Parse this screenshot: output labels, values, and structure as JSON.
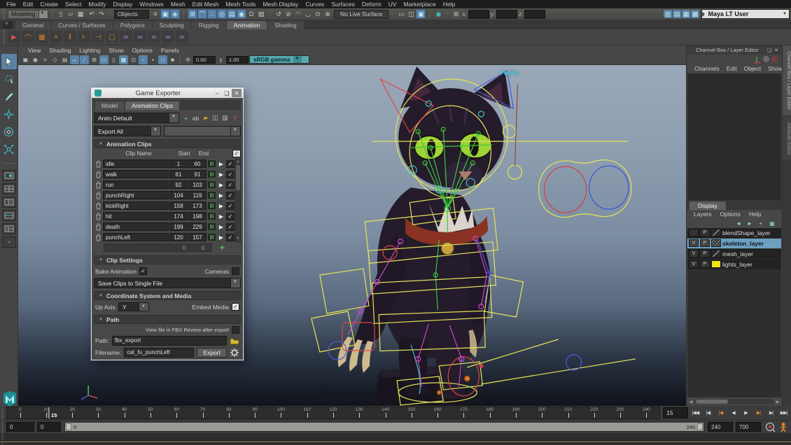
{
  "menubar": [
    "File",
    "Edit",
    "Create",
    "Select",
    "Modify",
    "Display",
    "Windows",
    "Mesh",
    "Edit Mesh",
    "Mesh Tools",
    "Mesh Display",
    "Curves",
    "Surfaces",
    "Deform",
    "UV",
    "Marketplace",
    "Help"
  ],
  "statusline": {
    "mode": "Modeling",
    "objects_filter": "Objects",
    "live_surface": "No Live Surface",
    "x_label": "x:",
    "y_label": "y:",
    "z_label": "z:",
    "user": "Maya LT User",
    "file_icons": [
      {
        "n": "new-scene-icon",
        "g": "▯"
      },
      {
        "n": "open-scene-icon",
        "g": "▱"
      },
      {
        "n": "save-scene-icon",
        "g": "▦"
      }
    ],
    "undo_icons": [
      {
        "n": "undo-icon",
        "g": "↶"
      },
      {
        "n": "redo-icon",
        "g": "↷"
      }
    ],
    "selection_mask_icons": [
      {
        "n": "select-hierarchy-icon",
        "g": "≡",
        "a": ""
      },
      {
        "n": "select-object-icon",
        "g": "▣",
        "a": "active"
      },
      {
        "n": "select-component-icon",
        "g": "◈",
        "a": "active"
      }
    ],
    "snap_icons": [
      {
        "n": "snap-grid-icon",
        "g": "⊞",
        "a": "active"
      },
      {
        "n": "snap-curve-icon",
        "g": "⌒",
        "a": "active"
      },
      {
        "n": "snap-point-icon",
        "g": "∴",
        "a": "active"
      },
      {
        "n": "snap-projected-center-icon",
        "g": "◎",
        "a": "active"
      },
      {
        "n": "snap-view-plane-icon",
        "g": "▤",
        "a": "active"
      },
      {
        "n": "make-live-icon",
        "g": "◉",
        "a": "active"
      },
      {
        "n": "lock-selection-icon",
        "g": "Ω",
        "a": ""
      },
      {
        "n": "highlight-selection-icon",
        "g": "▧",
        "a": ""
      }
    ],
    "history_icons": [
      {
        "n": "construction-history-icon",
        "g": "↺"
      },
      {
        "n": "no-construction-history-icon",
        "g": "⊘"
      },
      {
        "n": "evaluate-begin-icon",
        "g": "◠"
      },
      {
        "n": "evaluate-end-icon",
        "g": "◡"
      },
      {
        "n": "dirty-propagation-icon",
        "g": "⊙"
      },
      {
        "n": "cycle-check-icon",
        "g": "⊗"
      }
    ],
    "panel_icons": [
      {
        "n": "single-pane-icon",
        "g": "▭",
        "a": ""
      },
      {
        "n": "multi-pane-icon",
        "g": "◫",
        "a": ""
      },
      {
        "n": "hypershade-icon",
        "g": "▣",
        "a": "active"
      }
    ],
    "render_icons": [
      {
        "n": "render-view-icon",
        "g": "◉",
        "a": "teal"
      }
    ],
    "grid_icon": {
      "n": "grid-coords-icon",
      "g": "⊞"
    },
    "workspace_icons": [
      {
        "n": "ui-elements-toggle-icon",
        "g": "▥"
      },
      {
        "n": "channel-box-toggle-icon",
        "g": "▤"
      },
      {
        "n": "attribute-editor-toggle-icon",
        "g": "▦"
      },
      {
        "n": "tool-settings-toggle-icon",
        "g": "▩"
      }
    ],
    "user_icon_glyph": "☻"
  },
  "shelf": {
    "tabs": [
      {
        "label": "General",
        "state": ""
      },
      {
        "label": "Curves / Surfaces",
        "state": ""
      },
      {
        "label": "Polygons",
        "state": ""
      },
      {
        "label": "Sculpting",
        "state": ""
      },
      {
        "label": "Rigging",
        "state": ""
      },
      {
        "label": "Animation",
        "state": "active"
      },
      {
        "label": "Shading",
        "state": ""
      }
    ],
    "icons": [
      {
        "n": "playblast-icon",
        "g": "▶",
        "cls": "red"
      },
      {
        "n": "motion-trail-icon",
        "g": "⌒",
        "cls": ""
      },
      {
        "n": "dope-sheet-icon",
        "g": "▦",
        "cls": ""
      },
      {
        "n": "set-key-icon",
        "g": "+",
        "cls": ""
      },
      {
        "n": "set-breakdown-icon",
        "g": "‖",
        "cls": ""
      },
      {
        "n": "add-inbetween-icon",
        "g": "⊦",
        "cls": ""
      },
      {
        "n": "remove-inbetween-icon",
        "g": "⊣",
        "cls": ""
      },
      {
        "n": "anim-snapshot-icon",
        "g": "▢",
        "cls": ""
      },
      {
        "n": "parent-constraint-icon",
        "g": "∞",
        "cls": "purple"
      },
      {
        "n": "point-constraint-icon",
        "g": "∞",
        "cls": "purple"
      },
      {
        "n": "orient-constraint-icon",
        "g": "∞",
        "cls": "purple"
      },
      {
        "n": "aim-constraint-icon",
        "g": "∞",
        "cls": "purple"
      },
      {
        "n": "pole-vector-constraint-icon",
        "g": "∞",
        "cls": "purple"
      }
    ]
  },
  "panel_menu": {
    "items": [
      "View",
      "Shading",
      "Lighting",
      "Show",
      "Options",
      "Panels"
    ],
    "icons": [
      {
        "n": "select-camera-icon",
        "g": "▣",
        "a": ""
      },
      {
        "n": "lock-camera-icon",
        "g": "◉",
        "a": ""
      },
      {
        "n": "camera-attributes-icon",
        "g": "≡",
        "a": ""
      },
      {
        "n": "bookmark-icon",
        "g": "◇",
        "a": ""
      },
      {
        "n": "image-plane-icon",
        "g": "▤",
        "a": ""
      },
      {
        "n": "two-d-pan-zoom-icon",
        "g": "↔",
        "a": "on"
      },
      {
        "n": "grease-pencil-icon",
        "g": "∕",
        "a": "on"
      },
      {
        "n": "grid-toggle-icon",
        "g": "⊞",
        "a": ""
      },
      {
        "n": "film-gate-icon",
        "g": "▭",
        "a": "on"
      },
      {
        "n": "resolution-gate-icon",
        "g": "▯",
        "a": ""
      },
      {
        "n": "gate-mask-icon",
        "g": "▩",
        "a": "on"
      },
      {
        "n": "field-chart-icon",
        "g": "⊡",
        "a": ""
      },
      {
        "n": "safe-action-icon",
        "g": "▫",
        "a": "on"
      },
      {
        "n": "safe-title-icon",
        "g": "▪",
        "a": ""
      },
      {
        "n": "isolate-select-icon",
        "g": "□",
        "a": "on"
      },
      {
        "n": "xray-icon",
        "g": "■",
        "a": ""
      }
    ],
    "exposure": "0.00",
    "gamma": "1.00",
    "color_mode": "sRGB gamma"
  },
  "viewport": {
    "pupils_label": "Pupils",
    "panzoom_label": "2D Pan/Zoom : persp"
  },
  "exporter": {
    "title": "Game Exporter",
    "window_buttons": [
      {
        "n": "minimize-button",
        "g": "–",
        "cls": ""
      },
      {
        "n": "maximize-button",
        "g": "❑",
        "cls": ""
      },
      {
        "n": "close-button",
        "g": "✕",
        "cls": "close"
      }
    ],
    "tabs": [
      {
        "label": "Model",
        "state": ""
      },
      {
        "label": "Animation Clips",
        "state": "active"
      }
    ],
    "preset": "Anim Default",
    "preset_icons": [
      {
        "n": "create-anim-clip-set-icon",
        "g": "+",
        "cls": "ic-green"
      },
      {
        "n": "rename-anim-clip-set-icon",
        "g": "ab",
        "cls": ""
      },
      {
        "n": "load-anim-clip-set-icon",
        "g": "▰",
        "cls": "ic-folder"
      },
      {
        "n": "duplicate-anim-clip-set-icon",
        "g": "◫",
        "cls": ""
      },
      {
        "n": "delete-anim-clip-set-icon",
        "g": "▥",
        "cls": ""
      },
      {
        "n": "help-icon",
        "g": "?",
        "cls": "ic-red"
      }
    ],
    "export_mode": "Export All",
    "sections": {
      "clips": "Animation Clips",
      "clip_settings": "Clip Settings",
      "coordinate": "Coordinate System and Media",
      "path": "Path"
    },
    "clips_header": {
      "name": "Clip Name",
      "start": "Start",
      "end": "End"
    },
    "clips": [
      {
        "name": "idle",
        "start": "1",
        "end": "60"
      },
      {
        "name": "walk",
        "start": "61",
        "end": "91"
      },
      {
        "name": "run",
        "start": "92",
        "end": "103"
      },
      {
        "name": "punchRight",
        "start": "104",
        "end": "119"
      },
      {
        "name": "kickRight",
        "start": "158",
        "end": "173"
      },
      {
        "name": "hit",
        "start": "174",
        "end": "198"
      },
      {
        "name": "death",
        "start": "199",
        "end": "229"
      },
      {
        "name": "punchLeft",
        "start": "120",
        "end": "157"
      }
    ],
    "empty_row": {
      "start": "0",
      "end": "0"
    },
    "clip_settings": {
      "bake_label": "Bake Animation",
      "cameras_label": "Cameras",
      "save_mode": "Save Clips to Single File"
    },
    "coordinate": {
      "up_axis_label": "Up Axis",
      "up_axis": "Y",
      "embed_label": "Embed Media"
    },
    "path_section": {
      "fbx_review_label": "View file in FBX Review after export",
      "path_label": "Path:",
      "path_value": "fbx_export",
      "filename_label": "Filename:",
      "filename_value": "cat_fu_punchLeft",
      "export_label": "Export"
    }
  },
  "channel_box": {
    "title": "Channel Box / Layer Editor",
    "menus": [
      "Channels",
      "Edit",
      "Object",
      "Show"
    ],
    "side_tabs": [
      {
        "label": "Channel Box / Layer Editor",
        "state": ""
      },
      {
        "label": "Attribute Editor",
        "state": "dim"
      }
    ]
  },
  "layer_editor": {
    "tab": "Display",
    "menus": [
      "Layers",
      "Options",
      "Help"
    ],
    "toolbar_icons": [
      {
        "n": "previous-layer-icon",
        "g": "◄"
      },
      {
        "n": "next-layer-icon",
        "g": "►"
      },
      {
        "n": "create-empty-layer-icon",
        "g": "+"
      },
      {
        "n": "create-layer-from-selected-icon",
        "g": "▦"
      }
    ],
    "layers": [
      {
        "v": "",
        "p": "P",
        "swatch": "diag",
        "name": "blendShape_layer",
        "cls": ""
      },
      {
        "v": "V",
        "p": "P",
        "swatch": "hatch",
        "name": "skeleton_layer",
        "cls": "selected"
      },
      {
        "v": "V",
        "p": "P",
        "swatch": "diag",
        "name": "mesh_layer",
        "cls": ""
      },
      {
        "v": "V",
        "p": "P",
        "swatch": "yellow",
        "name": "lights_layer",
        "cls": ""
      }
    ]
  },
  "timeline": {
    "ticks": [
      0,
      10,
      20,
      30,
      40,
      50,
      60,
      70,
      80,
      90,
      100,
      110,
      120,
      130,
      140,
      150,
      160,
      170,
      180,
      190,
      200,
      210,
      220,
      230,
      240
    ],
    "range": [
      0,
      245
    ],
    "current_frame": 15,
    "current_frame_label": "15",
    "playback": [
      {
        "g": "|◀◀",
        "n": "go-to-start-button",
        "cls": ""
      },
      {
        "g": "|◀",
        "n": "step-back-frame-button",
        "cls": ""
      },
      {
        "g": "|◀",
        "n": "step-back-key-button",
        "cls": "orange"
      },
      {
        "g": "◀",
        "n": "play-backwards-button",
        "cls": ""
      },
      {
        "g": "▶",
        "n": "play-forwards-button",
        "cls": ""
      },
      {
        "g": "▶|",
        "n": "step-forward-key-button",
        "cls": "orange"
      },
      {
        "g": "▶|",
        "n": "step-forward-frame-button",
        "cls": ""
      },
      {
        "g": "▶▶|",
        "n": "go-to-end-button",
        "cls": ""
      }
    ]
  },
  "range_bar": {
    "anim_start": "0",
    "playback_start": "0",
    "bar_start_label": "0",
    "bar_end_label": "240",
    "playback_end": "240",
    "anim_end": "700"
  }
}
